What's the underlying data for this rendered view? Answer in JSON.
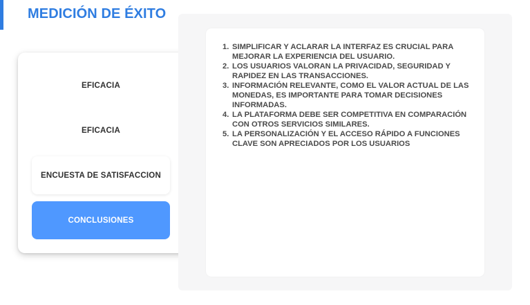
{
  "header": {
    "title": "MEDICIÓN DE ÉXITO",
    "accent_color": "#2f7de1"
  },
  "menu": {
    "items": [
      {
        "label": "EFICACIA",
        "active": false
      },
      {
        "label": "EFICACIA",
        "active": false
      },
      {
        "label": "ENCUESTA DE SATISFACCION",
        "active": false
      },
      {
        "label": "CONCLUSIONES",
        "active": true
      }
    ],
    "active_color": "#4f98ff"
  },
  "conclusions": {
    "items": [
      "SIMPLIFICAR Y ACLARAR LA INTERFAZ ES CRUCIAL PARA MEJORAR LA EXPERIENCIA DEL USUARIO.",
      "LOS USUARIOS VALORAN LA PRIVACIDAD, SEGURIDAD Y RAPIDEZ EN LAS TRANSACCIONES.",
      "INFORMACIÓN RELEVANTE, COMO EL VALOR ACTUAL DE LAS MONEDAS, ES IMPORTANTE PARA TOMAR DECISIONES INFORMADAS.",
      "LA PLATAFORMA DEBE SER COMPETITIVA EN COMPARACIÓN CON OTROS SERVICIOS SIMILARES.",
      "LA PERSONALIZACIÓN Y EL ACCESO RÁPIDO A FUNCIONES CLAVE SON APRECIADOS POR LOS USUARIOS"
    ]
  }
}
